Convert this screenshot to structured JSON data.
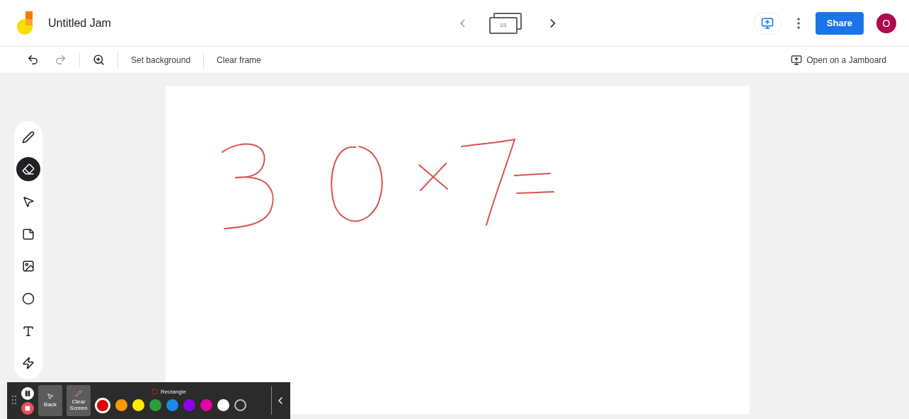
{
  "header": {
    "title": "Untitled Jam",
    "frame_counter": "1/1",
    "share": "Share",
    "avatar": "O"
  },
  "toolbar": {
    "items": [
      {
        "kind": "undo",
        "disabled": false
      },
      {
        "kind": "redo",
        "disabled": true
      },
      {
        "kind": "zoom",
        "disabled": false
      }
    ],
    "set_background": "Set background",
    "clear_frame": "Clear frame",
    "open_jamboard": "Open on a Jamboard"
  },
  "tools": [
    {
      "kind": "pen",
      "selected": false
    },
    {
      "kind": "eraser",
      "selected": true
    },
    {
      "kind": "select",
      "selected": false
    },
    {
      "kind": "note",
      "selected": false
    },
    {
      "kind": "image",
      "selected": false
    },
    {
      "kind": "circle",
      "selected": false
    },
    {
      "kind": "textbox",
      "selected": false
    },
    {
      "kind": "laser",
      "selected": false
    }
  ],
  "recorder": {
    "back": "Back",
    "clear_screen": "Clear Screen",
    "shape": "Rectangle",
    "colors": [
      {
        "color": "#e00000",
        "selected": true
      },
      {
        "color": "#ff9800",
        "selected": false
      },
      {
        "color": "#ffeb00",
        "selected": false
      },
      {
        "color": "#2e9e3a",
        "selected": false
      },
      {
        "color": "#1e88e5",
        "selected": false
      },
      {
        "color": "#8e00e8",
        "selected": false
      },
      {
        "color": "#e800a8",
        "selected": false
      },
      {
        "color": "#ffffff",
        "selected": false
      },
      {
        "color": "#222222",
        "selected": false
      }
    ]
  }
}
